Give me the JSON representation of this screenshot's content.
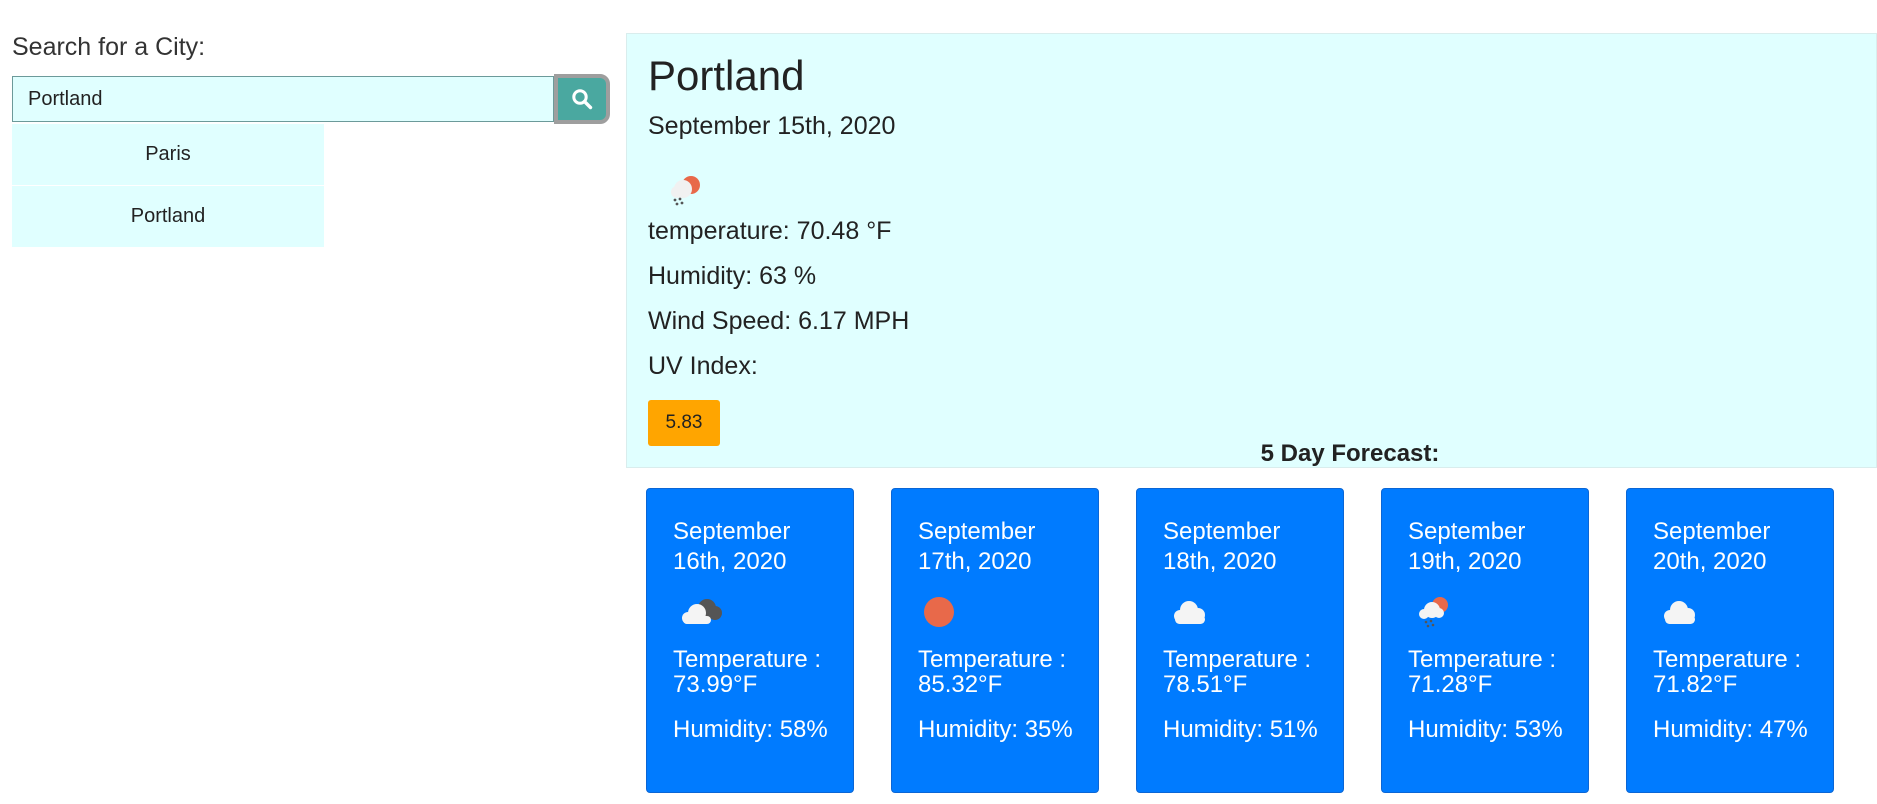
{
  "search": {
    "label": "Search for a City:",
    "value": "Portland",
    "button_icon": "search-icon",
    "history": [
      "Paris",
      "Portland"
    ]
  },
  "current": {
    "city": "Portland",
    "date": "September 15th, 2020",
    "icon": "rain-sun-icon",
    "temperature_text": "temperature: 70.48 °F",
    "humidity_text": "Humidity: 63 %",
    "wind_text": "Wind Speed: 6.17 MPH",
    "uv_label": "UV Index:",
    "uv_value": "5.83",
    "uv_color": "#ffa500"
  },
  "forecast": {
    "heading": "5 Day Forecast:",
    "days": [
      {
        "date": "September 16th, 2020",
        "icon": "broken-clouds-icon",
        "temperature": "Temperature : 73.99°F",
        "humidity": "Humidity: 58%"
      },
      {
        "date": "September 17th, 2020",
        "icon": "clear-sky-icon",
        "temperature": "Temperature : 85.32°F",
        "humidity": "Humidity: 35%"
      },
      {
        "date": "September 18th, 2020",
        "icon": "cloud-icon",
        "temperature": "Temperature : 78.51°F",
        "humidity": "Humidity: 51%"
      },
      {
        "date": "September 19th, 2020",
        "icon": "rain-sun-icon",
        "temperature": "Temperature : 71.28°F",
        "humidity": "Humidity: 53%"
      },
      {
        "date": "September 20th, 2020",
        "icon": "cloud-icon",
        "temperature": "Temperature : 71.82°F",
        "humidity": "Humidity: 47%"
      }
    ]
  },
  "colors": {
    "panel": "#e0ffff",
    "card": "#007bff",
    "search_button": "#4aa8a0"
  }
}
